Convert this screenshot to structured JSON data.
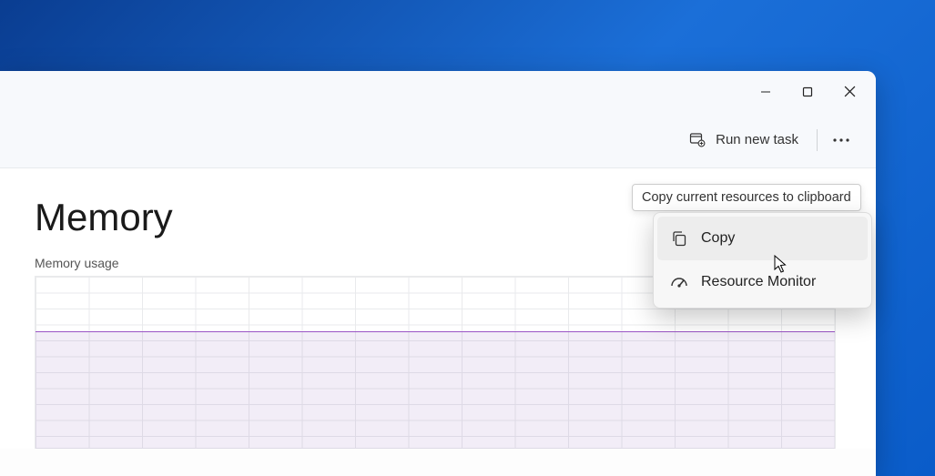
{
  "toolbar": {
    "run_label": "Run new task"
  },
  "page": {
    "title": "Memory",
    "chart_label": "Memory usage"
  },
  "menu": {
    "copy": "Copy",
    "resource_monitor": "Resource Monitor"
  },
  "tooltip": {
    "copy": "Copy current resources to clipboard"
  },
  "chart_data": {
    "type": "area",
    "title": "Memory usage",
    "xlabel": "",
    "ylabel": "",
    "ylim": [
      0,
      100
    ],
    "x_ticks": 16,
    "series": [
      {
        "name": "Memory usage (%)",
        "values": [
          68,
          68,
          68,
          68,
          69,
          69,
          69,
          68,
          68,
          68,
          69,
          69,
          69,
          68,
          68,
          68
        ]
      }
    ],
    "colors": {
      "line": "#9a54c4",
      "fill": "rgba(150,110,190,0.12)",
      "grid": "#e9eaec"
    }
  }
}
